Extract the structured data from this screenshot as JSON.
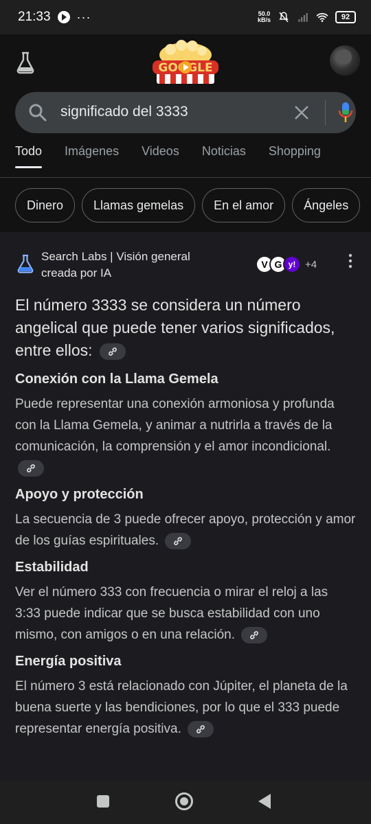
{
  "status_bar": {
    "time": "21:33",
    "dots": "···",
    "speed_top": "50.0",
    "speed_bottom": "kB/s",
    "battery": "92"
  },
  "search": {
    "query": "significado del 3333"
  },
  "tabs": [
    {
      "label": "Todo",
      "active": true
    },
    {
      "label": "Imágenes"
    },
    {
      "label": "Videos"
    },
    {
      "label": "Noticias"
    },
    {
      "label": "Shopping"
    }
  ],
  "chips": [
    "Dinero",
    "Llamas gemelas",
    "En el amor",
    "Ángeles"
  ],
  "ai_overview": {
    "title": "Search Labs | Visión general creada por IA",
    "sources": [
      {
        "letter": "V",
        "bg": "#ffffff",
        "fg": "#000000"
      },
      {
        "letter": "G",
        "bg": "#ffffff",
        "fg": "#000000"
      },
      {
        "letter": "y!",
        "bg": "#6001d2",
        "fg": "#ffffff"
      }
    ],
    "source_more": "+4",
    "lead": "El número 3333 se considera un número angelical que puede tener varios significados, entre ellos:",
    "sections": [
      {
        "heading": "Conexión con la Llama Gemela",
        "body": "Puede representar una conexión armoniosa y profunda con la Llama Gemela, y animar a nutrirla a través de la comunicación, la comprensión y el amor incondicional."
      },
      {
        "heading": "Apoyo y protección",
        "body": "La secuencia de 3 puede ofrecer apoyo, protección y amor de los guías espirituales."
      },
      {
        "heading": "Estabilidad",
        "body": "Ver el número 333 con frecuencia o mirar el reloj a las 3:33 puede indicar que se busca estabilidad con uno mismo, con amigos o en una relación."
      },
      {
        "heading": "Energía positiva",
        "body": "El número 3 está relacionado con Júpiter, el planeta de la buena suerte y las bendiciones, por lo que el 333 puede representar energía positiva."
      }
    ]
  },
  "colors": {
    "background": "#121212",
    "ai_background": "#1c1c20",
    "search_bar": "#3c4043",
    "text_primary": "#e3e3e3",
    "text_secondary": "#c4c7c5"
  }
}
